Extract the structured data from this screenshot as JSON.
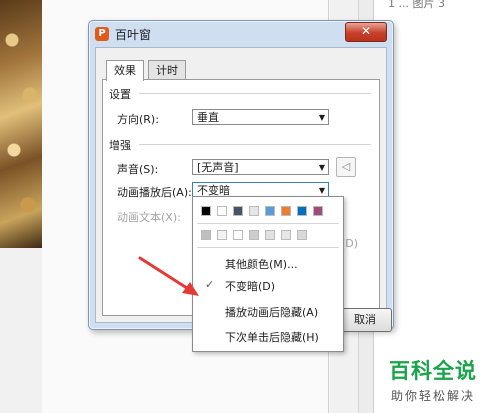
{
  "background": {
    "right_panel_tab": "1 ... 图片 3"
  },
  "dialog": {
    "title": "百叶窗",
    "close_symbol": "✕",
    "tabs": [
      {
        "label": "效果",
        "selected": true
      },
      {
        "label": "计时",
        "selected": false
      }
    ],
    "settings": {
      "section_title": "设置",
      "direction_label": "方向(R):",
      "direction_value": "垂直"
    },
    "enhancements": {
      "section_title": "增强",
      "sound_label": "声音(S):",
      "sound_value": "[无声音]",
      "after_animation_label": "动画播放后(A):",
      "after_animation_value": "不变暗",
      "animate_text_label": "动画文本(X):",
      "partial_label": "(D)"
    },
    "cancel_label": "取消"
  },
  "dropdown": {
    "colors_row1": [
      "#000000",
      "#ffffff",
      "#44546a",
      "#e7e6e6",
      "#5b9bd5",
      "#ed7d31",
      "#0070c0",
      "#a04c7a"
    ],
    "colors_row2": [
      "#bfbfbf",
      "#f2f2f2",
      "#ffffff",
      "#cccccc",
      "#e0e0e0",
      "#e6e6e6",
      "#d9d9d9"
    ],
    "items": [
      {
        "label": "其他颜色(M)...",
        "checked": false
      },
      {
        "label": "不变暗(D)",
        "checked": true
      },
      {
        "label": "播放动画后隐藏(A)",
        "checked": false
      },
      {
        "label": "下次单击后隐藏(H)",
        "checked": false
      }
    ],
    "check_symbol": "✓"
  },
  "annotation": {
    "arrow_color": "#e53935"
  },
  "watermark": {
    "title": "百科全说",
    "subtitle": "助你轻松解决"
  },
  "icons": {
    "app": "wps-presentation-icon",
    "speaker": "speaker-icon",
    "dropdown_arrow": "▼"
  }
}
